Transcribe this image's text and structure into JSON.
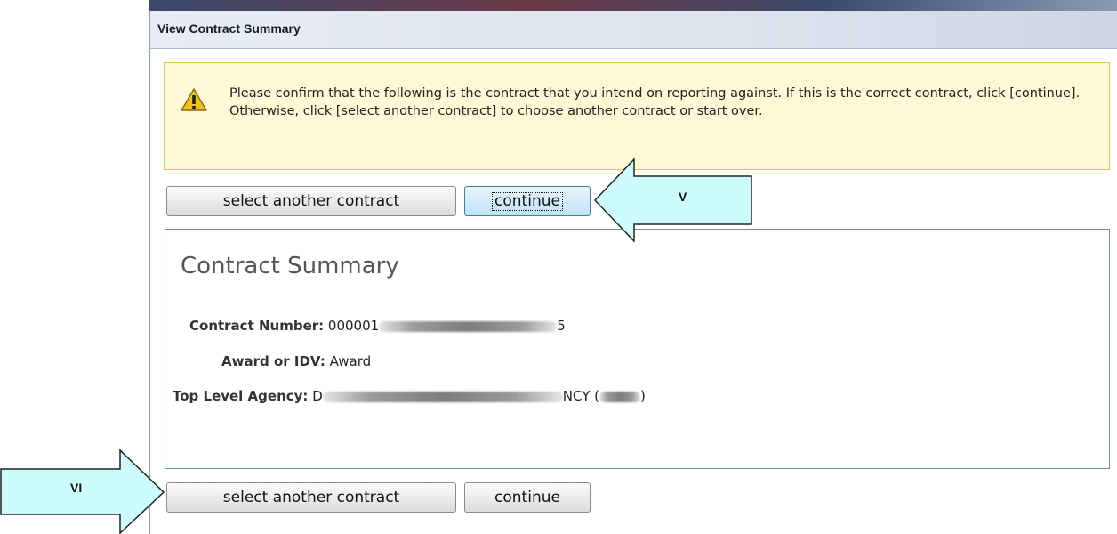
{
  "window": {
    "title": "View Contract Summary"
  },
  "alert": {
    "icon": "warning-icon",
    "message": "Please confirm that the following is the contract that you intend on reporting against. If this is the correct contract, click [continue]. Otherwise, click [select another contract] to choose another contract or start over."
  },
  "top_actions": {
    "select_another_label": "select another contract",
    "continue_label": "continue"
  },
  "summary": {
    "heading": "Contract Summary",
    "contract_number_label": "Contract Number:",
    "contract_number_visible_start": "000001",
    "contract_number_visible_end": "5",
    "award_idv_label": "Award or IDV:",
    "award_idv_value": "Award",
    "agency_label": "Top Level Agency:",
    "agency_visible_start": "D",
    "agency_visible_end": "NCY (",
    "agency_visible_close": ")"
  },
  "bottom_actions": {
    "select_another_label": "select another contract",
    "continue_label": "continue"
  },
  "callouts": {
    "top_label": "V",
    "bottom_label": "VI",
    "color": "#ccfcfc"
  },
  "colors": {
    "alert_bg": "#fdf8d6",
    "alert_border": "#e5c35a",
    "summary_border": "#6f8fb6",
    "focus_button": "#bfe3f7"
  }
}
